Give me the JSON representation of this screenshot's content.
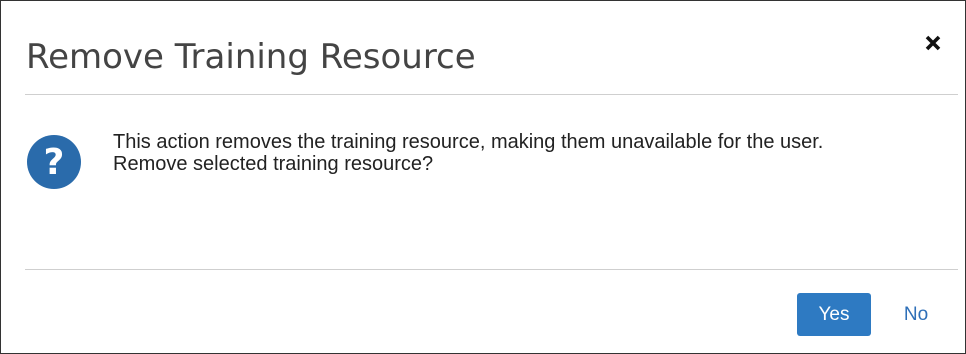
{
  "dialog": {
    "title": "Remove Training Resource",
    "close_icon": "close-icon",
    "question_icon": "question-icon",
    "message_lines": [
      "This action removes the training resource, making them unavailable for the user.",
      "Remove selected training resource?"
    ],
    "buttons": {
      "yes_label": "Yes",
      "no_label": "No"
    }
  },
  "colors": {
    "primary_button": "#2e7ac2",
    "link_button": "#2e6fb8",
    "question_icon": "#2a6bab",
    "title_text": "#444444",
    "divider": "#cfcfcf"
  }
}
